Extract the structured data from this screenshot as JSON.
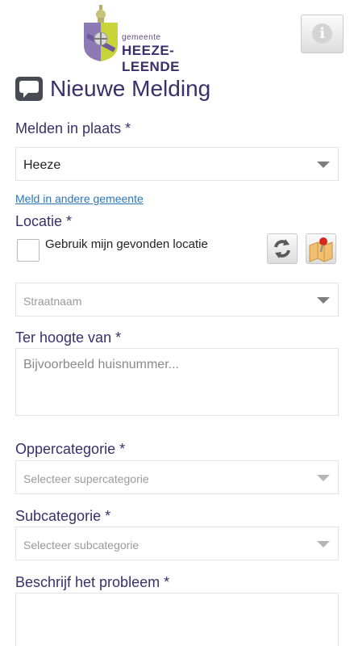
{
  "header": {
    "logo_small": "gemeente",
    "logo_name": "HEEZE-LEENDE",
    "info_icon": "info-icon"
  },
  "title": "Nieuwe Melding",
  "place": {
    "label": "Melden in plaats *",
    "value": "Heeze",
    "link": "Meld in andere gemeente"
  },
  "location": {
    "label": "Locatie *",
    "checkbox_label": "Gebruik mijn gevonden locatie",
    "street_placeholder": "Straatnaam",
    "refresh_icon": "refresh-icon",
    "map_icon": "map-pin-icon"
  },
  "near": {
    "label": "Ter hoogte van *",
    "placeholder": "Bijvoorbeeld huisnummer..."
  },
  "supercategory": {
    "label": "Oppercategorie *",
    "placeholder": "Selecteer supercategorie"
  },
  "subcategory": {
    "label": "Subcategorie *",
    "placeholder": "Selecteer subcategorie"
  },
  "description": {
    "label": "Beschrijf het probleem *"
  },
  "colors": {
    "accent": "#3a2f6b",
    "link": "#2a77b8"
  }
}
